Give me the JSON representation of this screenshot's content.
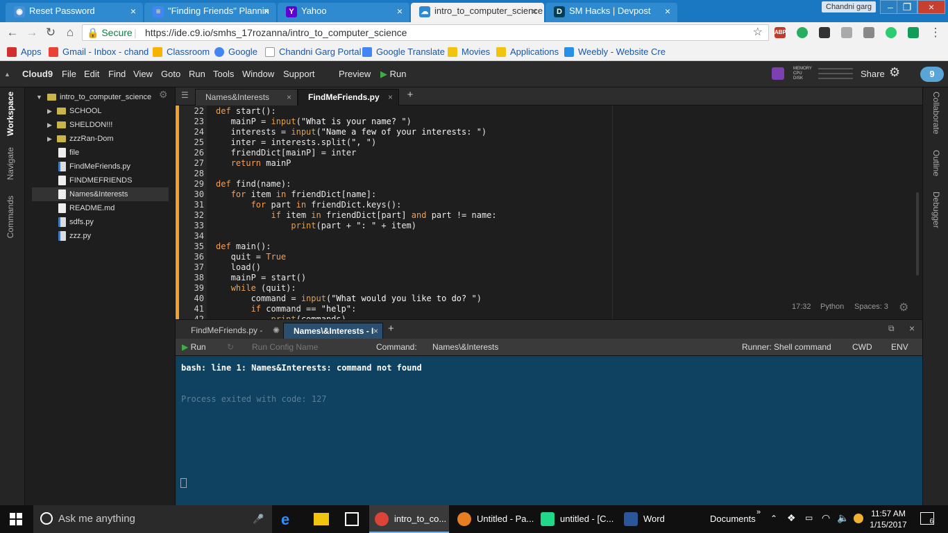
{
  "browser": {
    "tabs": [
      {
        "title": "Reset Password",
        "favicon": "eye-icon"
      },
      {
        "title": "\"Finding Friends\" Plannin",
        "favicon": "docs-icon"
      },
      {
        "title": "Yahoo",
        "favicon": "yahoo-icon"
      },
      {
        "title": "intro_to_computer_science",
        "favicon": "cloud9-icon"
      },
      {
        "title": "SM Hacks | Devpost",
        "favicon": "devpost-icon"
      }
    ],
    "user": "Chandni garg",
    "secure_label": "Secure",
    "url": "https://ide.c9.io/smhs_17rozanna/intro_to_computer_science",
    "bookmarks": [
      "Apps",
      "Gmail - Inbox - chand",
      "Classroom",
      "Google",
      "Chandni Garg Portal",
      "Google Translate",
      "Movies",
      "Applications",
      "Weebly - Website Cre"
    ]
  },
  "ide": {
    "brand": "Cloud9",
    "menus": [
      "File",
      "Edit",
      "Find",
      "View",
      "Goto",
      "Run",
      "Tools",
      "Window",
      "Support"
    ],
    "preview_label": "Preview",
    "run_label": "Run",
    "share_label": "Share",
    "notification_count": "9",
    "memory_labels": [
      "MEMORY",
      "CPU",
      "DISK"
    ],
    "left_rail": [
      "Workspace",
      "Navigate",
      "Commands"
    ],
    "right_rail": [
      "Collaborate",
      "Outline",
      "Debugger"
    ],
    "tree": {
      "root": "intro_to_computer_science",
      "items": [
        {
          "name": "SCHOOL",
          "type": "folder"
        },
        {
          "name": "SHELDON!!!",
          "type": "folder"
        },
        {
          "name": "zzzRan-Dom",
          "type": "folder"
        },
        {
          "name": "file",
          "type": "file"
        },
        {
          "name": "FindMeFriends.py",
          "type": "py"
        },
        {
          "name": "FINDMEFRIENDS",
          "type": "file"
        },
        {
          "name": "Names&Interests",
          "type": "file"
        },
        {
          "name": "README.md",
          "type": "file"
        },
        {
          "name": "sdfs.py",
          "type": "py"
        },
        {
          "name": "zzz.py",
          "type": "py"
        }
      ]
    },
    "editor_tabs": [
      "Names&Interests",
      "FindMeFriends.py"
    ],
    "code_lines": [
      {
        "n": "22",
        "text": "def start():"
      },
      {
        "n": "23",
        "text": "    mainP = input(\"What is your name? \")"
      },
      {
        "n": "24",
        "text": "    interests = input(\"Name a few of your interests: \")"
      },
      {
        "n": "25",
        "text": "    inter = interests.split(\", \")"
      },
      {
        "n": "26",
        "text": "    friendDict[mainP] = inter"
      },
      {
        "n": "27",
        "text": "    return mainP"
      },
      {
        "n": "28",
        "text": ""
      },
      {
        "n": "29",
        "text": "def find(name):"
      },
      {
        "n": "30",
        "text": "    for item in friendDict[name]:"
      },
      {
        "n": "31",
        "text": "        for part in friendDict.keys():"
      },
      {
        "n": "32",
        "text": "            if item in friendDict[part] and part != name:"
      },
      {
        "n": "33",
        "text": "                print(part + \": \" + item)"
      },
      {
        "n": "34",
        "text": ""
      },
      {
        "n": "35",
        "text": "def main():"
      },
      {
        "n": "36",
        "text": "    quit = True"
      },
      {
        "n": "37",
        "text": "    load()"
      },
      {
        "n": "38",
        "text": "    mainP = start()"
      },
      {
        "n": "39",
        "text": "    while (quit):"
      },
      {
        "n": "40",
        "text": "        command = input(\"What would you like to do? \")"
      },
      {
        "n": "41",
        "text": "        if command == \"help\":"
      },
      {
        "n": "42",
        "text": "            print(commands)"
      }
    ],
    "editor_status": {
      "position": "17:32",
      "language": "Python",
      "spaces": "Spaces: 3"
    },
    "console_tabs": [
      "FindMeFriends.py -",
      "Names\\&Interests - I"
    ],
    "runner": {
      "run_label": "Run",
      "config_placeholder": "Run Config Name",
      "command_label": "Command:",
      "command_value": "Names\\&Interests",
      "runner_label": "Runner: Shell command",
      "cwd_label": "CWD",
      "env_label": "ENV"
    },
    "console": {
      "line1": "bash: line 1: Names&Interests: command not found",
      "line2": "Process exited with code: 127"
    }
  },
  "taskbar": {
    "search_placeholder": "Ask me anything",
    "apps": [
      {
        "label": "intro_to_co...",
        "icon": "chrome-icon"
      },
      {
        "label": "Untitled - Pa...",
        "icon": "paint-icon"
      },
      {
        "label": "untitled - [C...",
        "icon": "pycharm-icon"
      },
      {
        "label": "Word",
        "icon": "word-icon"
      }
    ],
    "documents_label": "Documents",
    "time": "11:57 AM",
    "date": "1/15/2017",
    "notification_badge": "6"
  },
  "colors": {
    "chrome_blue": "#1a78c2",
    "editor_bg": "#1e1e1e",
    "console_bg": "#0f4160",
    "accent_orange": "#f0a030"
  }
}
